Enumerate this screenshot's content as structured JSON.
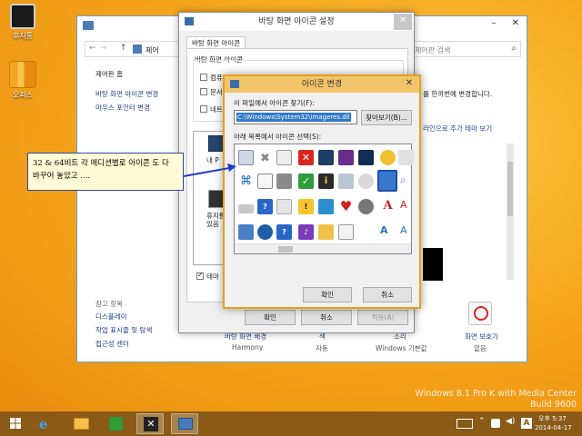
{
  "desktop": {
    "icons": [
      {
        "label": "휴지통"
      },
      {
        "label": "오피스"
      }
    ],
    "watermark": {
      "line1": "Windows 8.1 Pro K with Media Center",
      "line2": "Build 9600"
    }
  },
  "control_panel": {
    "address": "제어",
    "search_placeholder": "제어판 검색",
    "sidebar": {
      "home": "제어판 홈",
      "links": [
        "바탕 화면 아이콘 변경",
        "마우스 포인터 변경"
      ],
      "see_also_title": "참고 항목",
      "see_also": [
        "디스플레이",
        "작업 표시줄 및 탐색",
        "접근성 센터"
      ]
    },
    "main_text": "를 한꺼번에 변경합니다.",
    "online_link": "라인으로 추가 테마 보기",
    "bottom_items": [
      {
        "label": "바탕 화면 배경",
        "sub": "Harmony"
      },
      {
        "label": "색",
        "sub": "자동"
      },
      {
        "label": "소리",
        "sub": "Windows 기본값"
      },
      {
        "label": "화면 보호기",
        "sub": "없음"
      }
    ]
  },
  "desktop_icon_settings": {
    "title": "바탕 화면 아이콘 설정",
    "tab": "바탕 화면 아이콘",
    "group_label": "바탕 화면 아이콘",
    "checkboxes": [
      {
        "label": "컴퓨",
        "checked": false
      },
      {
        "label": "문서",
        "checked": false
      },
      {
        "label": "네트",
        "checked": false
      }
    ],
    "preview_labels": [
      "내 P",
      "휴지통\n있음"
    ],
    "theme_checkbox": "테마",
    "ok": "확인",
    "cancel": "취소",
    "apply": "적용(A)"
  },
  "change_icon": {
    "title": "아이콘 변경",
    "file_label": "이 파일에서 아이콘 찾기(F):",
    "file_value": "C:\\Windows\\System32\\imageres.dll",
    "browse": "찾아보기(B)...",
    "list_label": "아래 목록에서 아이콘 선택(S):",
    "ok": "확인",
    "cancel": "취소"
  },
  "callout": {
    "text": "32 & 64비트 각 에디션별로 아이콘 도 다 바꾸어 놓았고 ...."
  },
  "taskbar": {
    "clock_time": "오후 5:37",
    "clock_date": "2014-04-17"
  }
}
